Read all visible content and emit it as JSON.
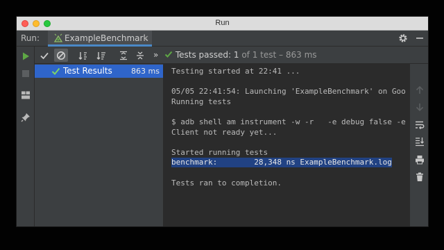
{
  "window": {
    "title": "Run"
  },
  "tabbar": {
    "run_label": "Run:",
    "tab_label": "ExampleBenchmark",
    "tab_close": "×",
    "settings_icon": "gear-icon",
    "hide_icon": "minimize-icon"
  },
  "toolbar": {
    "status_passed": "Tests passed:",
    "status_count": "1",
    "status_rest": "of 1 test – 863 ms",
    "more": "»"
  },
  "tree": {
    "label": "Test Results",
    "time": "863 ms"
  },
  "console": {
    "lines": [
      "Testing started at 22:41 ...",
      "",
      "05/05 22:41:54: Launching 'ExampleBenchmark' on Goo",
      "Running tests",
      "",
      "$ adb shell am instrument -w -r   -e debug false -e",
      "Client not ready yet...",
      "",
      "Started running tests",
      "benchmark:        28,348 ns ExampleBenchmark.log",
      "",
      "Tests ran to completion."
    ],
    "highlight_index": 9
  },
  "colors": {
    "success": "#5ea845",
    "selection": "#2f65ca",
    "highlight": "#214283"
  }
}
